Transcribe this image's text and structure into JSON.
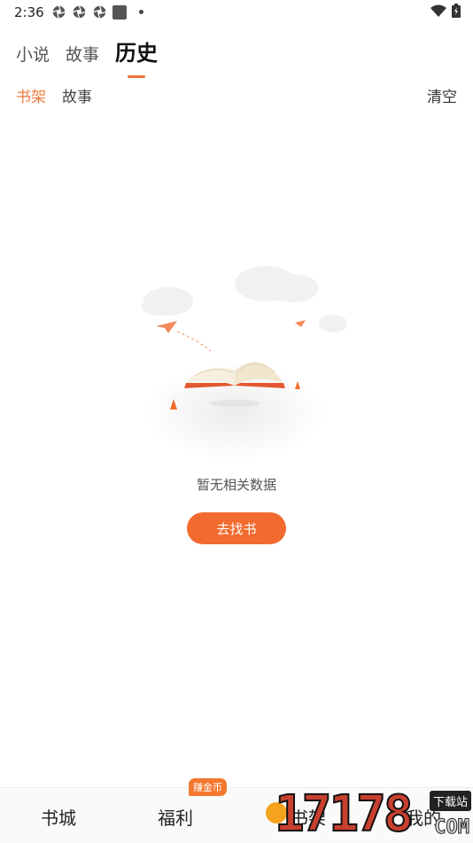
{
  "status": {
    "time": "2:36",
    "icons": [
      "aperture-icon",
      "aperture-icon",
      "aperture-icon",
      "square-icon",
      "dot-icon"
    ],
    "right_icons": [
      "wifi-icon",
      "battery-icon"
    ]
  },
  "top_tabs": [
    {
      "label": "小说",
      "active": false
    },
    {
      "label": "故事",
      "active": false
    },
    {
      "label": "历史",
      "active": true
    }
  ],
  "sub_tabs": [
    {
      "label": "书架",
      "active": true
    },
    {
      "label": "故事",
      "active": false
    }
  ],
  "clear_label": "清空",
  "empty": {
    "illustration": "open-book-with-paper-planes-illustration",
    "message": "暂无相关数据",
    "button_label": "去找书"
  },
  "bottom_nav": {
    "items": [
      "书城",
      "福利",
      "书架",
      "我的"
    ],
    "badge": "赚金币"
  },
  "watermark": {
    "digits": "17178",
    "tag": "下载站",
    "domain": "COM"
  },
  "colors": {
    "accent": "#f26a2d",
    "active_subtab": "#f07a3f"
  }
}
